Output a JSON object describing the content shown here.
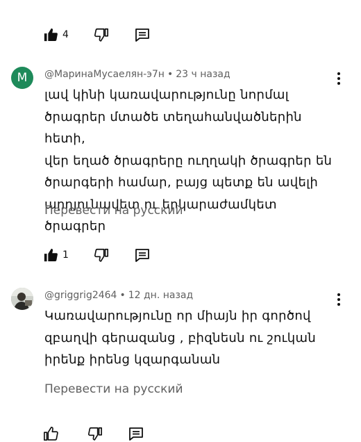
{
  "top_actions": {
    "like_count": "4"
  },
  "comments": [
    {
      "avatar_letter": "M",
      "avatar_color": "#1e8a5a",
      "author": "@МаринаМусаелян-э7н",
      "time": "23 ч назад",
      "lines": [
        "լավ կինի կառավարությունը նորմալ",
        "ծրագրեր մտածե տեղահանվածներին հետի,",
        "վեր եղած ծրագրերը ուղղակի ծրագրեր են",
        "ծրարգերի համար, բայց պետք են ավելի",
        "արդյունավետ ու երկարաժամկետ ծրագրեր"
      ],
      "translate": "Перевести на русский",
      "like_count": "1"
    },
    {
      "avatar_letter": "",
      "avatar_color": "#8a8f88",
      "author": "@griggrig2464",
      "time": "12 дн. назад",
      "lines": [
        "Կառավարությունը որ միայն  իր գործով",
        "զբաղվի գերազանց , բիզնեսն ու շուկան",
        "իրենք իրենց կզարգանան"
      ],
      "translate": "Перевести на русский",
      "like_count": ""
    }
  ]
}
